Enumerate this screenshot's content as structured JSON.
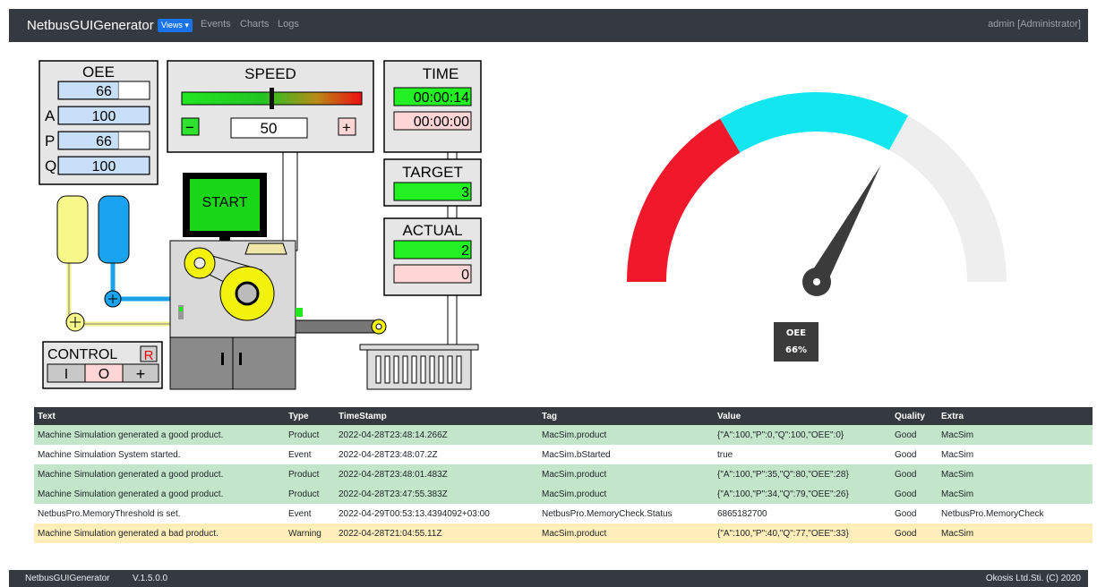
{
  "navbar": {
    "brand": "NetbusGUIGenerator",
    "views_label": "Views ▾",
    "links": [
      "Events",
      "Charts",
      "Logs"
    ],
    "user": "admin [Administrator]"
  },
  "simulation": {
    "oee": {
      "title": "OEE",
      "rows": [
        {
          "label": "",
          "value": "66",
          "fill": 0.66
        },
        {
          "label": "A",
          "value": "100",
          "fill": 1.0
        },
        {
          "label": "P",
          "value": "66",
          "fill": 0.66
        },
        {
          "label": "Q",
          "value": "100",
          "fill": 1.0
        }
      ]
    },
    "speed": {
      "title": "SPEED",
      "value": "50",
      "minus": "−",
      "plus": "+",
      "level": 0.5
    },
    "time": {
      "title": "TIME",
      "running": "00:00:14",
      "stopped": "00:00:00"
    },
    "target": {
      "title": "TARGET",
      "value": "3"
    },
    "actual": {
      "title": "ACTUAL",
      "good": "2",
      "bad": "0"
    },
    "start_label": "START",
    "control": {
      "title": "CONTROL",
      "reset": "R",
      "btn_on": "I",
      "btn_off": "O",
      "btn_add": "+"
    }
  },
  "gauge": {
    "label": "OEE",
    "value_text": "66%",
    "value": 66,
    "colors": {
      "low": "#f0192c",
      "mid": "#12e6ef",
      "high": "#eeeeee",
      "needle": "#3b3b3b"
    }
  },
  "log": {
    "headers": [
      "Text",
      "Type",
      "TimeStamp",
      "Tag",
      "Value",
      "Quality",
      "Extra"
    ],
    "rows": [
      [
        "Machine Simulation generated a good product.",
        "Product",
        "2022-04-28T23:48:14.266Z",
        "MacSim.product",
        "{\"A\":100,\"P\":0,\"Q\":100,\"OEE\":0}",
        "Good",
        "MacSim"
      ],
      [
        "Machine Simulation System started.",
        "Event",
        "2022-04-28T23:48:07.2Z",
        "MacSim.bStarted",
        "true",
        "Good",
        "MacSim"
      ],
      [
        "Machine Simulation generated a good product.",
        "Product",
        "2022-04-28T23:48:01.483Z",
        "MacSim.product",
        "{\"A\":100,\"P\":35,\"Q\":80,\"OEE\":28}",
        "Good",
        "MacSim"
      ],
      [
        "Machine Simulation generated a good product.",
        "Product",
        "2022-04-28T23:47:55.383Z",
        "MacSim.product",
        "{\"A\":100,\"P\":34,\"Q\":79,\"OEE\":26}",
        "Good",
        "MacSim"
      ],
      [
        "NetbusPro.MemoryThreshold is set.",
        "Event",
        "2022-04-29T00:53:13.4394092+03:00",
        "NetbusPro.MemoryCheck.Status",
        "6865182700",
        "Good",
        "NetbusPro.MemoryCheck"
      ],
      [
        "Machine Simulation generated a bad product.",
        "Warning",
        "2022-04-28T21:04:55.11Z",
        "MacSim.product",
        "{\"A\":100,\"P\":40,\"Q\":77,\"OEE\":33}",
        "Good",
        "MacSim"
      ]
    ]
  },
  "footer": {
    "app": "NetbusGUIGenerator",
    "version": "V.1.5.0.0",
    "copyright": "Okosis Ltd.Sti. (C) 2020"
  }
}
